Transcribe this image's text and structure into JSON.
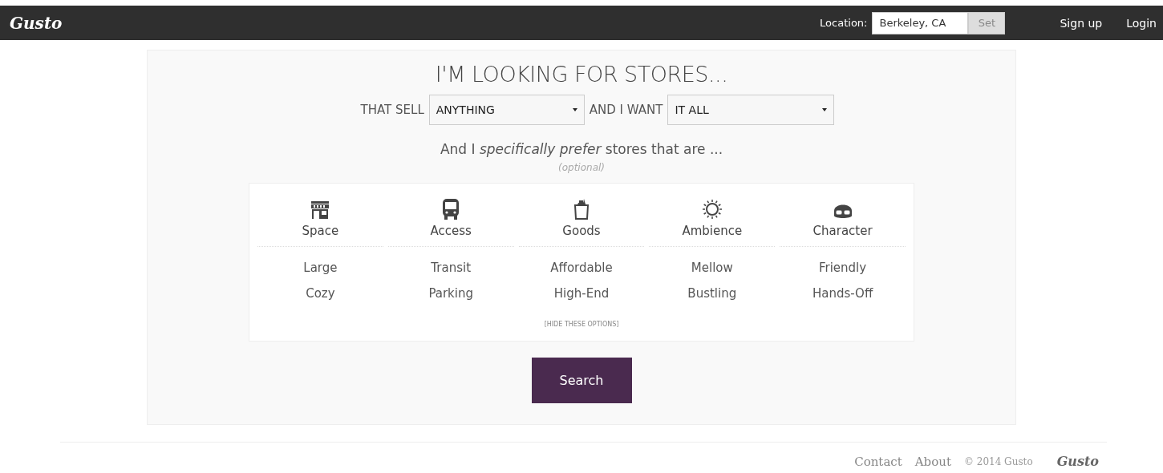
{
  "header": {
    "logo": "Gusto",
    "location_label": "Location:",
    "location_value": "Berkeley, CA",
    "set_button": "Set",
    "links": [
      "Sign up",
      "Login"
    ]
  },
  "search": {
    "title": "I'M LOOKING FOR STORES...",
    "sell_label": "THAT SELL",
    "sell_value": "ANYTHING",
    "want_label": "AND I WANT",
    "want_value": "IT ALL",
    "prefer": "And I *specifically prefer* stores that are ...",
    "optional": "(optional)",
    "categories": [
      {
        "name": "Space",
        "options": [
          "Large",
          "Cozy"
        ]
      },
      {
        "name": "Access",
        "options": [
          "Transit",
          "Parking"
        ]
      },
      {
        "name": "Goods",
        "options": [
          "Affordable",
          "High-End"
        ]
      },
      {
        "name": "Ambience",
        "options": [
          "Mellow",
          "Bustling"
        ]
      },
      {
        "name": "Character",
        "options": [
          "Friendly",
          "Hands-Off"
        ]
      }
    ],
    "hide_link": "[HIDE THESE OPTIONS]",
    "search_button": "Search"
  },
  "footer": {
    "links": [
      "Contact",
      "About"
    ],
    "copyright": "© 2014 Gusto",
    "logo": "Gusto"
  }
}
